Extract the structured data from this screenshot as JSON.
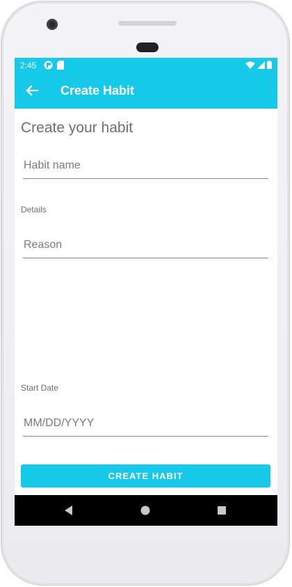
{
  "status_bar": {
    "time": "2:45",
    "icons": [
      "notification-app-icon",
      "sd-card-icon",
      "wifi-icon",
      "signal-icon",
      "battery-icon"
    ]
  },
  "app_bar": {
    "title": "Create Habit",
    "back_icon": "arrow-back-icon"
  },
  "form": {
    "heading": "Create your habit",
    "habit_name_placeholder": "Habit name",
    "details_label": "Details",
    "reason_placeholder": "Reason",
    "start_date_label": "Start Date",
    "date_placeholder": "MM/DD/YYYY",
    "submit_label": "CREATE HABIT"
  },
  "nav_bar": {
    "icons": [
      "back-triangle-icon",
      "home-circle-icon",
      "recents-square-icon"
    ]
  },
  "colors": {
    "accent": "#17c9e8",
    "nav_bar": "#000000",
    "text_muted": "#6f6f6f"
  }
}
